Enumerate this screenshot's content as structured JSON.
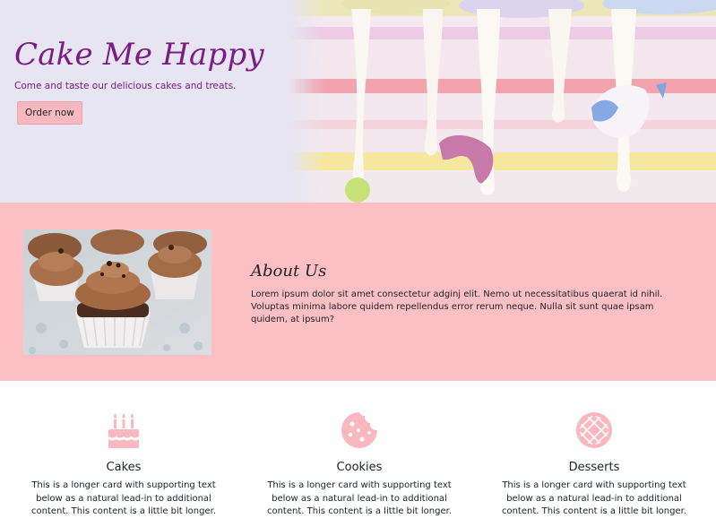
{
  "hero": {
    "title": "Cake Me Happy",
    "subtitle": "Come and taste our delicious cakes and treats.",
    "cta_label": "Order now"
  },
  "about": {
    "title": "About Us",
    "text": "Lorem ipsum dolor sit amet consectetur adginj elit. Nemo ut necessitatibus quaerat id nihil. Voluptas minima labore quidem repellendus error rerum neque. Nulla sit sunt quae ipsam quidem, at ipsum?"
  },
  "features": [
    {
      "icon": "birthday-cake-icon",
      "title": "Cakes",
      "text": "This is a longer card with supporting text below as a natural lead-in to additional content. This content is a little bit longer."
    },
    {
      "icon": "cookie-icon",
      "title": "Cookies",
      "text": "This is a longer card with supporting text below as a natural lead-in to additional content. This content is a little bit longer."
    },
    {
      "icon": "pie-icon",
      "title": "Desserts",
      "text": "This is a longer card with supporting text below as a natural lead-in to additional content. This content is a little bit longer."
    }
  ],
  "colors": {
    "brand_purple": "#7b1b84",
    "pink": "#fbbfc4",
    "icon_pink": "#f9b8c0"
  }
}
